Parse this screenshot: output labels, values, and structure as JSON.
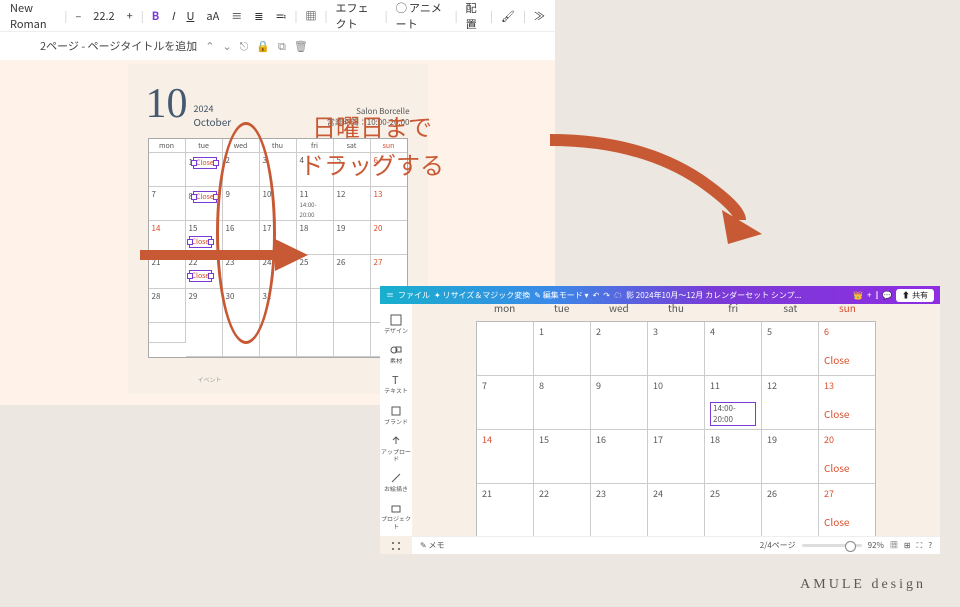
{
  "toolbar1": {
    "font": "New Roman",
    "minus": "–",
    "size": "22.2",
    "plus": "+",
    "bold": "B",
    "italic": "I",
    "underline": "U",
    "case": "aA",
    "effect": "エフェクト",
    "animate": "アニメート",
    "placement": "配置"
  },
  "subbar": {
    "title": "2ページ - ページタイトルを追加"
  },
  "cal1": {
    "bignum": "10",
    "year": "2024",
    "month": "October",
    "salon_name": "Salon Borcelle",
    "salon_hours": "営業時間：10:00-20:00",
    "days": [
      "mon",
      "tue",
      "wed",
      "thu",
      "fri",
      "sat",
      "sun"
    ],
    "close": "Close",
    "time": "14:00-20:00",
    "event": "イベント"
  },
  "annotation": {
    "line1": "日曜日まで",
    "line2": "ドラッグする"
  },
  "toolbar2": {
    "file": "ファイル",
    "resize": "リサイズ＆マジック変換",
    "editmode": "編集モード",
    "doc": "影  2024年10月〜12月  カレンダーセット  シンプ...",
    "share": "共有"
  },
  "sidebar2": {
    "design": "デザイン",
    "element": "素材",
    "text": "テキスト",
    "brand": "ブランド",
    "upload": "アップロード",
    "draw": "お絵描き",
    "project": "プロジェクト",
    "app": "アプリ"
  },
  "cal2": {
    "days": [
      "mon",
      "tue",
      "wed",
      "thu",
      "fri",
      "sat",
      "sun"
    ],
    "close": "Close",
    "time": "14:00-20:00"
  },
  "bottombar2": {
    "memo": "メモ",
    "pages": "2/4ページ",
    "zoom": "92%"
  },
  "brand": "AMULE design"
}
